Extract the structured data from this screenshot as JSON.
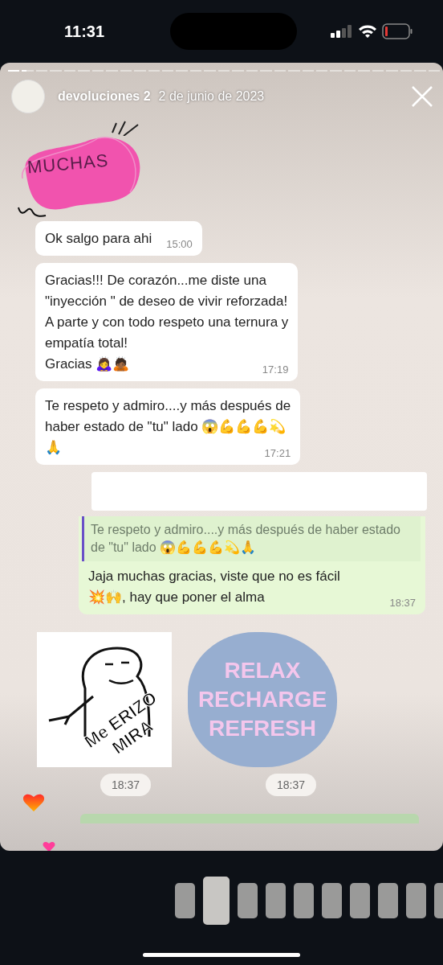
{
  "status_bar": {
    "time": "11:31"
  },
  "story": {
    "progress": [
      {
        "viewed": true,
        "selected": false
      },
      {
        "viewed": false,
        "selected": true
      },
      {
        "viewed": false,
        "selected": false
      },
      {
        "viewed": false,
        "selected": false
      },
      {
        "viewed": false,
        "selected": false
      },
      {
        "viewed": false,
        "selected": false
      },
      {
        "viewed": false,
        "selected": false
      },
      {
        "viewed": false,
        "selected": false
      },
      {
        "viewed": false,
        "selected": false
      },
      {
        "viewed": false,
        "selected": false
      },
      {
        "viewed": false,
        "selected": false
      },
      {
        "viewed": false,
        "selected": false
      },
      {
        "viewed": false,
        "selected": false
      },
      {
        "viewed": false,
        "selected": false
      },
      {
        "viewed": false,
        "selected": false
      },
      {
        "viewed": false,
        "selected": false
      },
      {
        "viewed": false,
        "selected": false
      },
      {
        "viewed": false,
        "selected": false
      },
      {
        "viewed": false,
        "selected": false
      },
      {
        "viewed": false,
        "selected": false
      },
      {
        "viewed": false,
        "selected": false
      },
      {
        "viewed": false,
        "selected": false
      },
      {
        "viewed": false,
        "selected": false
      },
      {
        "viewed": false,
        "selected": false
      },
      {
        "viewed": false,
        "selected": false
      },
      {
        "viewed": false,
        "selected": false
      },
      {
        "viewed": false,
        "selected": false
      },
      {
        "viewed": false,
        "selected": false
      },
      {
        "viewed": false,
        "selected": false
      },
      {
        "viewed": false,
        "selected": false
      },
      {
        "viewed": false,
        "selected": false
      }
    ],
    "username": "devoluciones 2",
    "date": "2 de junio de 2023"
  },
  "chat": {
    "sticker_text": "MUCHAS",
    "messages": [
      {
        "kind": "incoming",
        "text": "Ok salgo para ahi",
        "time": "15:00"
      },
      {
        "kind": "incoming",
        "text": "Gracias!!! De corazón...me diste una\n\"inyección \" de deseo de vivir reforzada!\nA parte y con todo respeto una ternura y\nempatía total!\nGracias 🙇‍♀️🙇🏾",
        "time": "17:19"
      },
      {
        "kind": "incoming",
        "text": "Te respeto y admiro....y más después de\nhaber estado de \"tu\" lado 😱💪💪💪💫\n🙏",
        "time": "17:21"
      },
      {
        "kind": "outgoing",
        "quote": "Te respeto y admiro....y más después de haber estado de \"tu\" lado 😱💪💪💪💫🙏",
        "text": "Jaja muchas gracias, viste que no es fácil\n💥🙌, hay que poner el alma",
        "time": "18:37"
      }
    ],
    "stickers": [
      {
        "kind": "meme",
        "lines": [
          "Me ERIZO",
          "MIRA"
        ],
        "time": "18:37"
      },
      {
        "kind": "cloud",
        "lines": [
          "RELAX",
          "RECHARGE",
          "REFRESH"
        ],
        "time": "18:37"
      }
    ]
  },
  "tray": [
    {
      "selected": false
    },
    {
      "selected": true
    },
    {
      "selected": false
    },
    {
      "selected": false
    },
    {
      "selected": false
    },
    {
      "selected": false
    },
    {
      "selected": false
    },
    {
      "selected": false
    },
    {
      "selected": false
    },
    {
      "selected": false
    }
  ]
}
